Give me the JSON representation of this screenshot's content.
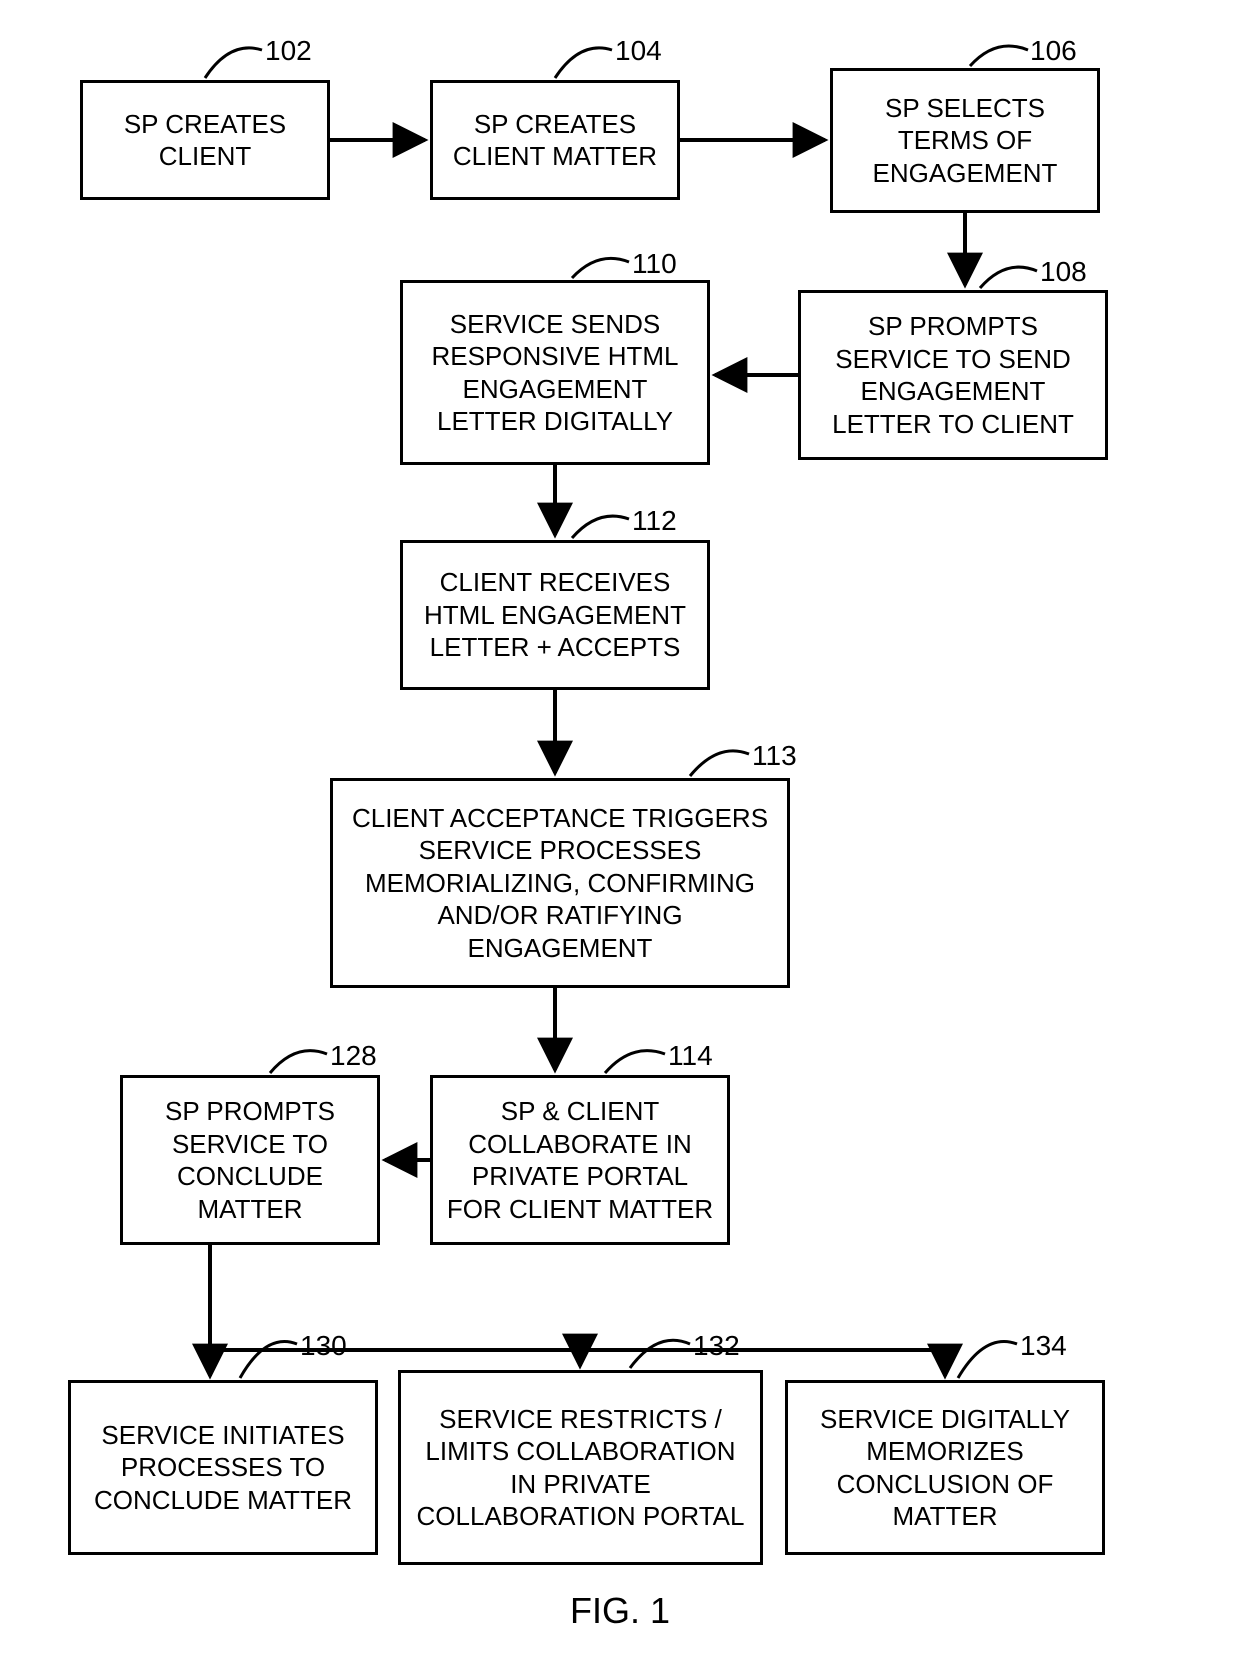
{
  "figure_label": "FIG. 1",
  "nodes": {
    "n102": {
      "num": "102",
      "text": "SP CREATES CLIENT"
    },
    "n104": {
      "num": "104",
      "text": "SP CREATES CLIENT MATTER"
    },
    "n106": {
      "num": "106",
      "text": "SP SELECTS TERMS OF ENGAGEMENT"
    },
    "n108": {
      "num": "108",
      "text": "SP PROMPTS SERVICE TO SEND ENGAGEMENT LETTER TO CLIENT"
    },
    "n110": {
      "num": "110",
      "text": "SERVICE SENDS RESPONSIVE HTML ENGAGEMENT LETTER DIGITALLY"
    },
    "n112": {
      "num": "112",
      "text": "CLIENT RECEIVES HTML ENGAGEMENT LETTER + ACCEPTS"
    },
    "n113": {
      "num": "113",
      "text": "CLIENT ACCEPTANCE TRIGGERS SERVICE PROCESSES MEMORIALIZING, CONFIRMING AND/OR RATIFYING ENGAGEMENT"
    },
    "n114": {
      "num": "114",
      "text": "SP & CLIENT COLLABORATE IN PRIVATE PORTAL FOR CLIENT MATTER"
    },
    "n128": {
      "num": "128",
      "text": "SP PROMPTS SERVICE TO CONCLUDE MATTER"
    },
    "n130": {
      "num": "130",
      "text": "SERVICE INITIATES PROCESSES TO CONCLUDE MATTER"
    },
    "n132": {
      "num": "132",
      "text": "SERVICE RESTRICTS / LIMITS COLLABORATION IN PRIVATE COLLABORATION PORTAL"
    },
    "n134": {
      "num": "134",
      "text": "SERVICE DIGITALLY MEMORIZES CONCLUSION OF MATTER"
    }
  }
}
